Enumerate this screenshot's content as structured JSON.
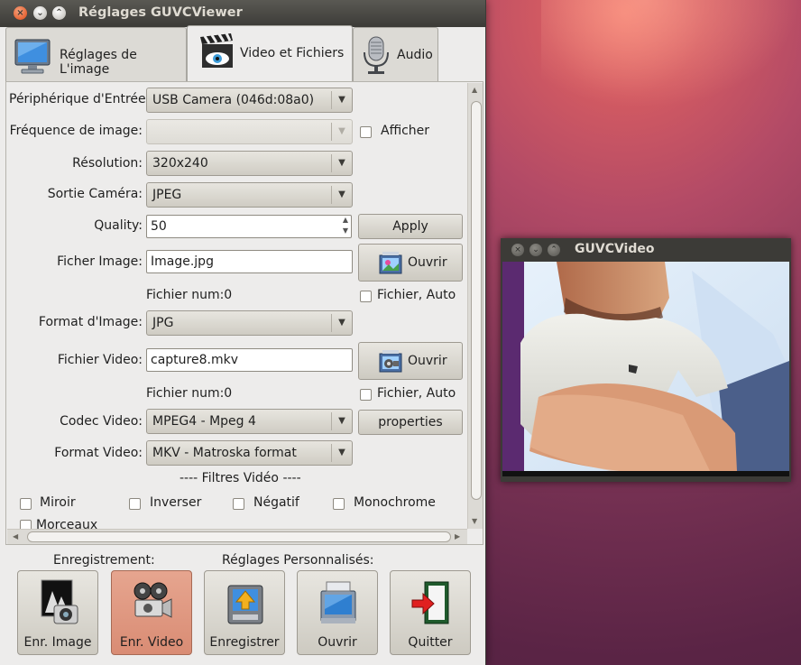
{
  "window": {
    "title": "Réglages GUVCViewer"
  },
  "tabs": [
    {
      "label": "Réglages de L'image",
      "active": false
    },
    {
      "label": "Video et Fichiers",
      "active": true
    },
    {
      "label": "Audio",
      "active": false
    }
  ],
  "form": {
    "device_label": "Périphérique d'Entrée:",
    "device_value": "USB Camera (046d:08a0)",
    "fps_label": "Fréquence de image:",
    "fps_value": "",
    "show_label": "Afficher",
    "resolution_label": "Résolution:",
    "resolution_value": "320x240",
    "camout_label": "Sortie Caméra:",
    "camout_value": "JPEG",
    "quality_label": "Quality:",
    "quality_value": "50",
    "apply_label": "Apply",
    "image_file_label": "Ficher Image:",
    "image_file_value": "Image.jpg",
    "open_label": "Ouvrir",
    "image_num": "Fichier num:0",
    "auto_label": "Fichier, Auto",
    "image_format_label": "Format d'Image:",
    "image_format_value": "JPG",
    "video_file_label": "Fichier Video:",
    "video_file_value": "capture8.mkv",
    "video_num": "Fichier num:0",
    "codec_label": "Codec Video:",
    "codec_value": "MPEG4 - Mpeg 4",
    "properties_label": "properties",
    "video_format_label": "Format Video:",
    "video_format_value": "MKV - Matroska format",
    "filters_title": "---- Filtres Vidéo ----",
    "filters": [
      "Miroir",
      "Inverser",
      "Négatif",
      "Monochrome",
      "Morceaux"
    ]
  },
  "bottom": {
    "record_title": "Enregistrement:",
    "custom_title": "Réglages Personnalisés:",
    "buttons": [
      "Enr. Image",
      "Enr. Video",
      "Enregistrer",
      "Ouvrir",
      "Quitter"
    ]
  },
  "video_window": {
    "title": "GUVCVideo"
  }
}
